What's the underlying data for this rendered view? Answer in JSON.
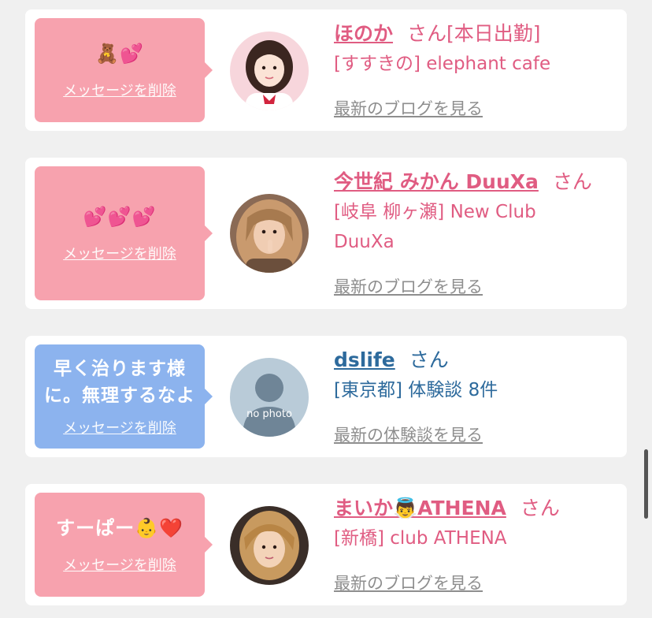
{
  "entries": [
    {
      "message": "🧸💕",
      "delete_label": "メッセージを削除",
      "name": "ほのか",
      "san": "さん",
      "sub_suffix": "[本日出勤]",
      "sub": "[すすきの] elephant cafe",
      "link": "最新のブログを見る"
    },
    {
      "message": "💕💕💕",
      "delete_label": "メッセージを削除",
      "name": "今世紀 みかん DuuXa",
      "san": "さん",
      "sub": "[岐阜 柳ヶ瀬] New Club DuuXa",
      "link": "最新のブログを見る"
    },
    {
      "message": "早く治ります様に。無理するなよ",
      "delete_label": "メッセージを削除",
      "name": "dslife",
      "san": "さん",
      "sub": "[東京都] 体験談 8件",
      "link": "最新の体験談を見る",
      "avatar_text": "no photo"
    },
    {
      "message": "すーぱー👶❤️",
      "delete_label": "メッセージを削除",
      "name": "まいか👼ATHENA",
      "san": "さん",
      "sub": "[新橋] club ATHENA",
      "link": "最新のブログを見る"
    }
  ],
  "colors": {
    "pink_accent": "#e05c82",
    "pink_bubble": "#f7a2ae",
    "blue_accent": "#2d6a9c",
    "blue_bubble": "#8cb3ee",
    "link_gray": "#8e8e8e",
    "background": "#f0f0f0"
  }
}
